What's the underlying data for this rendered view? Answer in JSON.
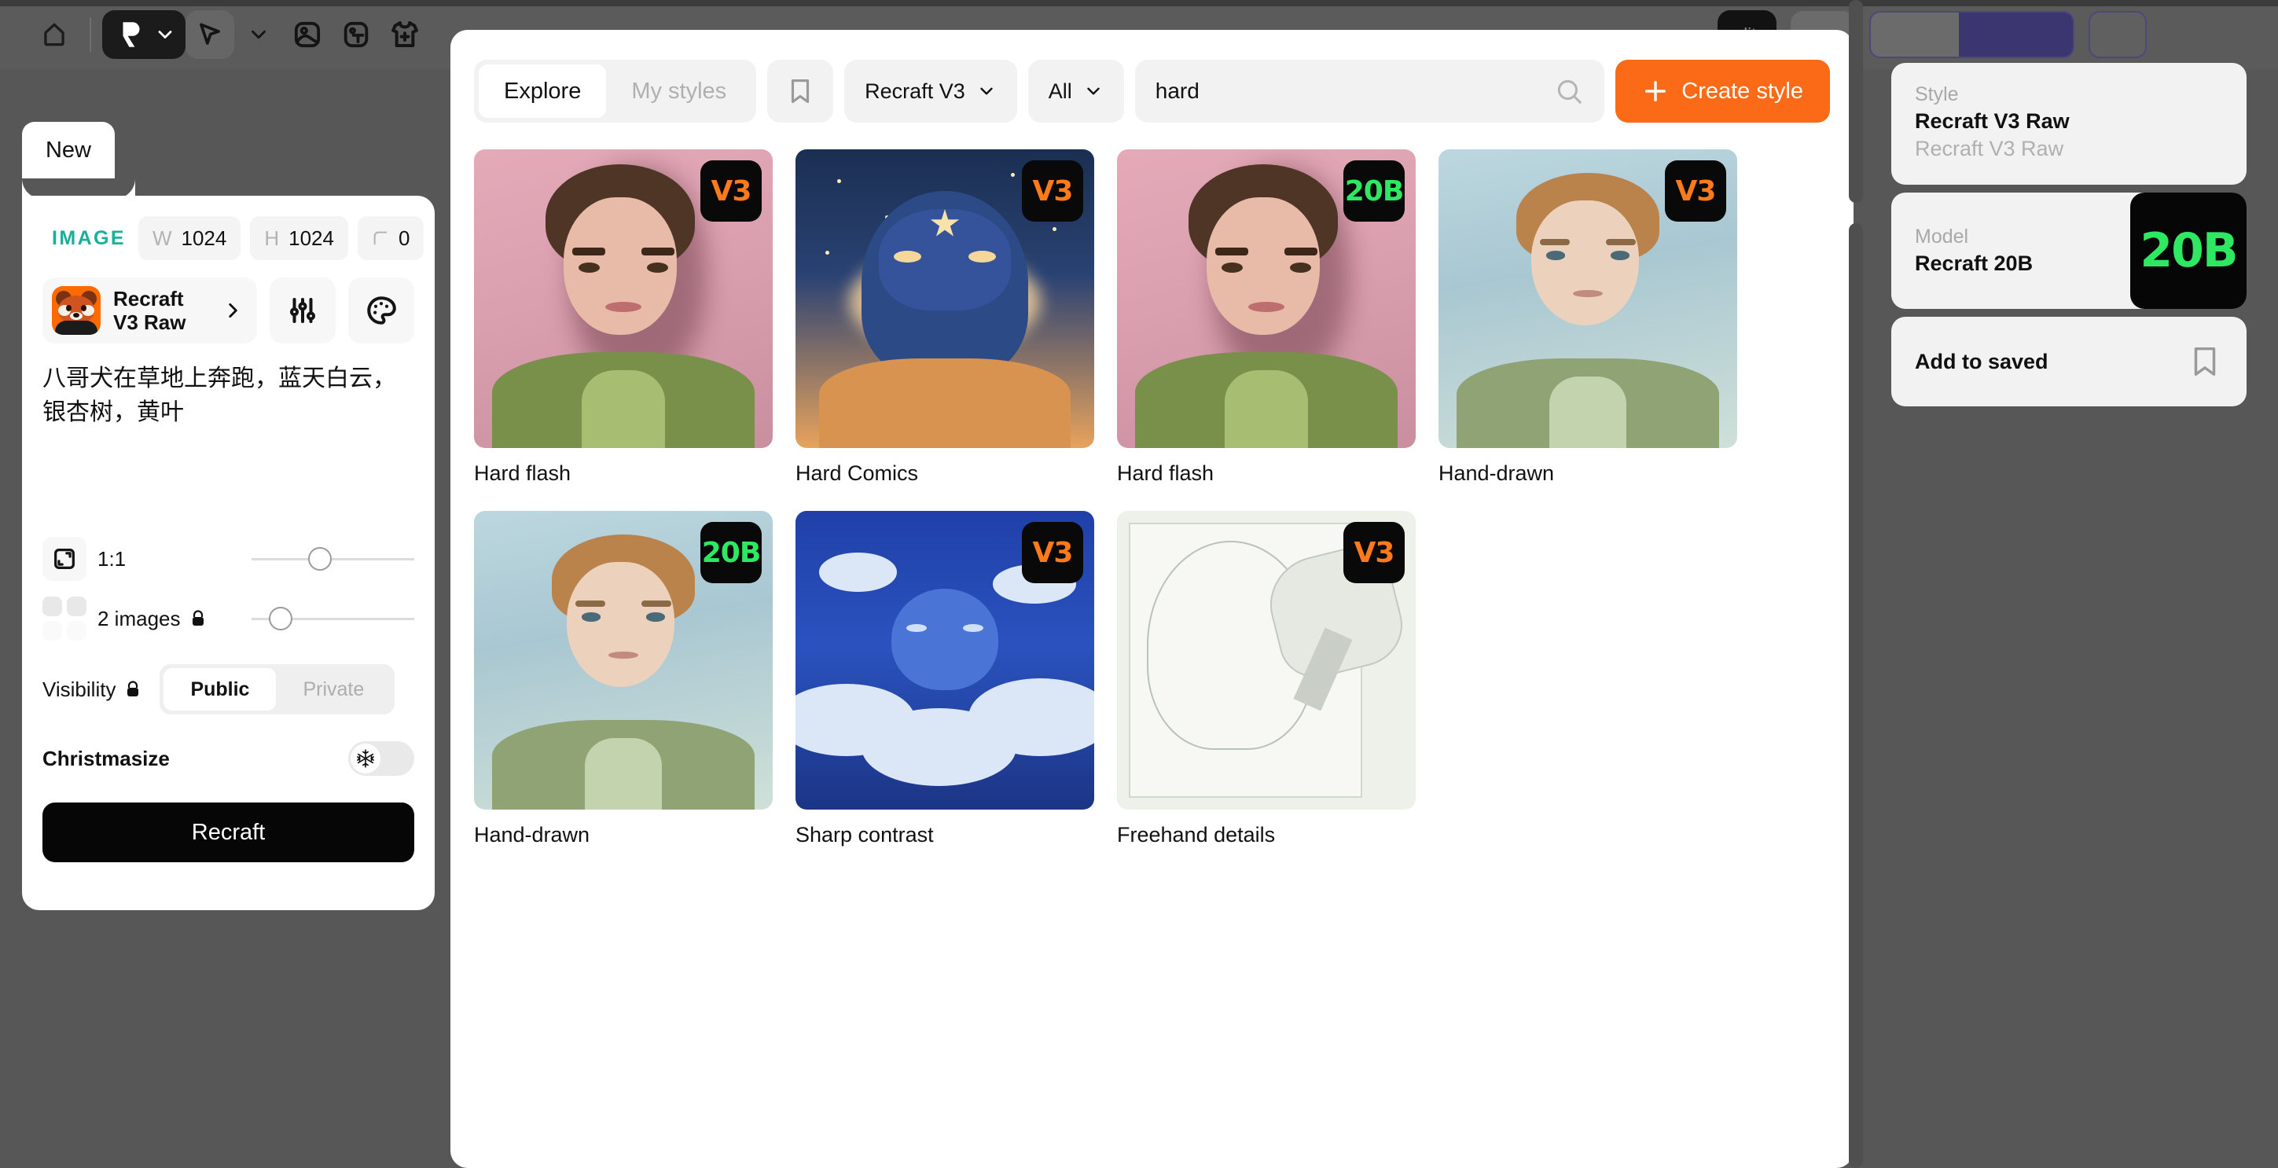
{
  "toolbar": {
    "home_icon": "home-icon",
    "logo_icon": "recraft-logo-icon",
    "cursor_icon": "cursor-select-icon",
    "image_icon": "image-tool-icon",
    "text_icon": "text-tool-icon",
    "mockup_icon": "tshirt-mockup-icon",
    "credits_label": "dit"
  },
  "left_panel": {
    "tab_label": "New",
    "type_label": "IMAGE",
    "image_icon": "image-icon",
    "width_key": "W",
    "width_value": "1024",
    "height_key": "H",
    "height_value": "1024",
    "corner_key": "corner-radius-icon",
    "corner_value": "0",
    "model_name": "Recraft\nV3 Raw",
    "model_name_line1": "Recraft",
    "model_name_line2": "V3 Raw",
    "chevron_icon": "chevron-right-icon",
    "settings_icon": "sliders-icon",
    "palette_icon": "palette-icon",
    "prompt_text": "八哥犬在草地上奔跑，蓝天白云，银杏树，黄叶",
    "aspect_ratio_label": "1:1",
    "aspect_icon": "aspect-ratio-icon",
    "images_count_label": "2 images",
    "images_lock_icon": "lock-icon",
    "grid_icon": "image-count-grid-icon",
    "visibility_label": "Visibility",
    "visibility_lock_icon": "lock-icon",
    "visibility_options": [
      "Public",
      "Private"
    ],
    "visibility_selected": "Public",
    "christmasize_label": "Christmasize",
    "christmasize_icon": "snowflake-icon",
    "christmasize_on": false,
    "generate_label": "Recraft"
  },
  "style_browser": {
    "tabs": [
      "Explore",
      "My styles"
    ],
    "tab_selected": "Explore",
    "bookmark_icon": "bookmark-icon",
    "model_filter": "Recraft V3",
    "category_filter": "All",
    "chevron_icon": "chevron-down-icon",
    "search_value": "hard",
    "search_icon": "search-icon",
    "create_label": "Create style",
    "plus_icon": "plus-icon",
    "styles": [
      {
        "name": "Hard flash",
        "badge": "V3",
        "badge_color": "#ff7a1a",
        "art": "portrait-pink"
      },
      {
        "name": "Hard Comics",
        "badge": "V3",
        "badge_color": "#ff7a1a",
        "art": "comic"
      },
      {
        "name": "Hard flash",
        "badge": "20B",
        "badge_color": "#2ee862",
        "art": "portrait-pink"
      },
      {
        "name": "Hand-drawn",
        "badge": "V3",
        "badge_color": "#ff7a1a",
        "art": "water"
      },
      {
        "name": "Hand-drawn",
        "badge": "20B",
        "badge_color": "#2ee862",
        "art": "water"
      },
      {
        "name": "Sharp contrast",
        "badge": "V3",
        "badge_color": "#ff7a1a",
        "art": "clouds"
      },
      {
        "name": "Freehand details",
        "badge": "V3",
        "badge_color": "#ff7a1a",
        "art": "sketch"
      }
    ]
  },
  "right_panel": {
    "style_key": "Style",
    "style_value": "Recraft V3 Raw",
    "style_sub": "Recraft V3 Raw",
    "model_key": "Model",
    "model_value": "Recraft 20B",
    "model_badge": "20B",
    "save_label": "Add to saved",
    "save_icon": "bookmark-icon"
  }
}
